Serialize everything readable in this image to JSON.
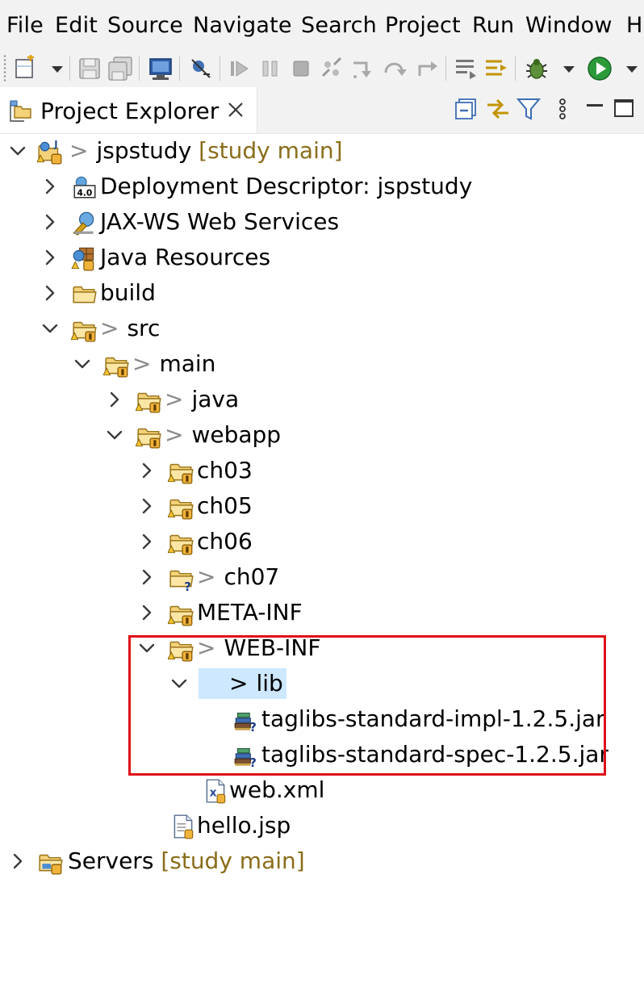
{
  "menu": {
    "items": [
      "File",
      "Edit",
      "Source",
      "Navigate",
      "Search",
      "Project",
      "Run",
      "Window",
      "H"
    ]
  },
  "toolbar": {
    "icons": [
      "new-icon",
      "dropdown-icon",
      "save-icon",
      "save-all-icon",
      "terminal-icon",
      "skip-breakpoints-icon",
      "resume-icon",
      "suspend-icon",
      "terminate-icon",
      "disconnect-icon",
      "step-into-icon",
      "step-over-icon",
      "step-return-icon",
      "drop-to-frame-icon",
      "use-step-filters-icon",
      "debug-icon",
      "run-icon"
    ]
  },
  "view": {
    "tab_label": "Project Explorer",
    "actions": [
      "collapse-all-icon",
      "link-with-editor-icon",
      "filter-icon",
      "view-menu-icon",
      "minimize-icon",
      "maximize-icon"
    ]
  },
  "tree": {
    "prefix_symbol": ">",
    "rows": [
      {
        "label": "jspstudy",
        "decoration": "[study main]",
        "expanded": true,
        "icon": "project-icon"
      },
      {
        "label": "Deployment Descriptor: jspstudy",
        "expanded": false,
        "icon": "deployment-descriptor-icon"
      },
      {
        "label": "JAX-WS Web Services",
        "expanded": false,
        "icon": "web-services-icon"
      },
      {
        "label": "Java Resources",
        "expanded": false,
        "icon": "java-resources-icon"
      },
      {
        "label": "build",
        "expanded": false,
        "icon": "folder-icon"
      },
      {
        "label": "src",
        "expanded": true,
        "icon": "folder-git-icon"
      },
      {
        "label": "main",
        "expanded": true,
        "icon": "folder-git-icon"
      },
      {
        "label": "java",
        "expanded": false,
        "icon": "folder-git-icon"
      },
      {
        "label": "webapp",
        "expanded": true,
        "icon": "folder-git-icon"
      },
      {
        "label": "ch03",
        "expanded": false,
        "icon": "folder-git-icon"
      },
      {
        "label": "ch05",
        "expanded": false,
        "icon": "folder-git-icon"
      },
      {
        "label": "ch06",
        "expanded": false,
        "icon": "folder-git-icon"
      },
      {
        "label": "ch07",
        "expanded": false,
        "icon": "folder-untracked-icon"
      },
      {
        "label": "META-INF",
        "expanded": false,
        "icon": "folder-git-icon"
      },
      {
        "label": "WEB-INF",
        "expanded": true,
        "icon": "folder-git-icon"
      },
      {
        "label": "lib",
        "expanded": true,
        "icon": "folder-untracked-icon"
      },
      {
        "label": "taglibs-standard-impl-1.2.5.jar",
        "icon": "jar-untracked-icon"
      },
      {
        "label": "taglibs-standard-spec-1.2.5.jar",
        "icon": "jar-untracked-icon"
      },
      {
        "label": "web.xml",
        "icon": "xml-file-icon"
      },
      {
        "label": "hello.jsp",
        "icon": "jsp-file-icon"
      },
      {
        "label": "Servers",
        "decoration": "[study main]",
        "expanded": false,
        "icon": "project-folder-icon"
      }
    ]
  },
  "colors": {
    "selection": "#cde8ff",
    "annotation": "#e0101a",
    "decoration": "#8a6d1a"
  }
}
